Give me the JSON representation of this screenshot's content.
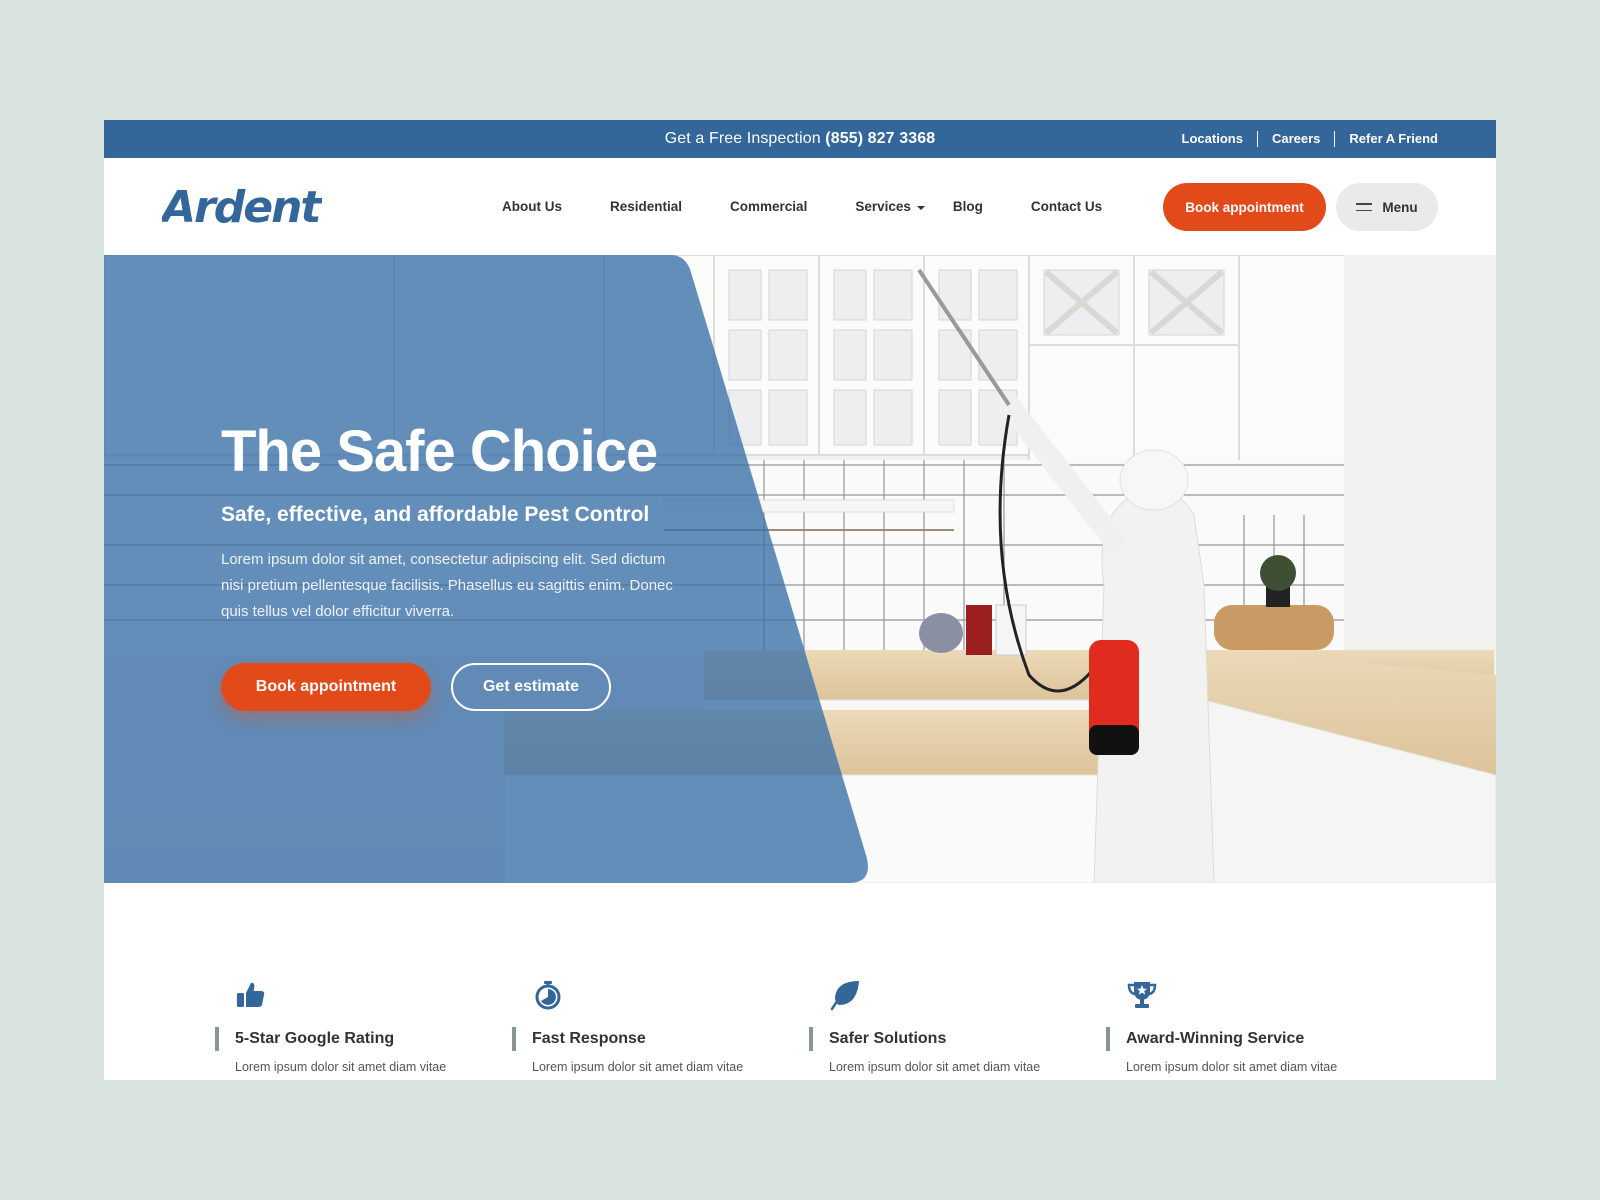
{
  "topbar": {
    "promo_label": "Get a Free Inspection",
    "phone": "(855) 827 3368",
    "links": [
      "Locations",
      "Careers",
      "Refer A Friend"
    ]
  },
  "header": {
    "logo_text": "Ardent",
    "nav": [
      "About Us",
      "Residential",
      "Commercial",
      "Services",
      "Blog",
      "Contact Us"
    ],
    "book_label": "Book appointment",
    "menu_label": "Menu"
  },
  "hero": {
    "title": "The Safe Choice",
    "subtitle": "Safe, effective, and affordable Pest Control",
    "text": "Lorem ipsum dolor sit amet, consectetur adipiscing elit. Sed dictum nisi pretium pellentesque facilisis. Phasellus eu sagittis enim. Donec quis tellus vel dolor efficitur viverra.",
    "primary_button": "Book appointment",
    "secondary_button": "Get estimate"
  },
  "features": [
    {
      "icon": "thumbs-up-icon",
      "title": "5-Star Google Rating",
      "text": "Lorem ipsum dolor sit amet diam vitae"
    },
    {
      "icon": "stopwatch-icon",
      "title": "Fast Response",
      "text": "Lorem ipsum dolor sit amet diam vitae"
    },
    {
      "icon": "leaf-icon",
      "title": "Safer Solutions",
      "text": "Lorem ipsum dolor sit amet diam vitae"
    },
    {
      "icon": "trophy-icon",
      "title": "Award-Winning Service",
      "text": "Lorem ipsum dolor sit amet diam vitae"
    }
  ],
  "colors": {
    "brand_blue": "#336699",
    "accent_orange": "#e24a1a",
    "page_background": "#d9e3e0"
  }
}
